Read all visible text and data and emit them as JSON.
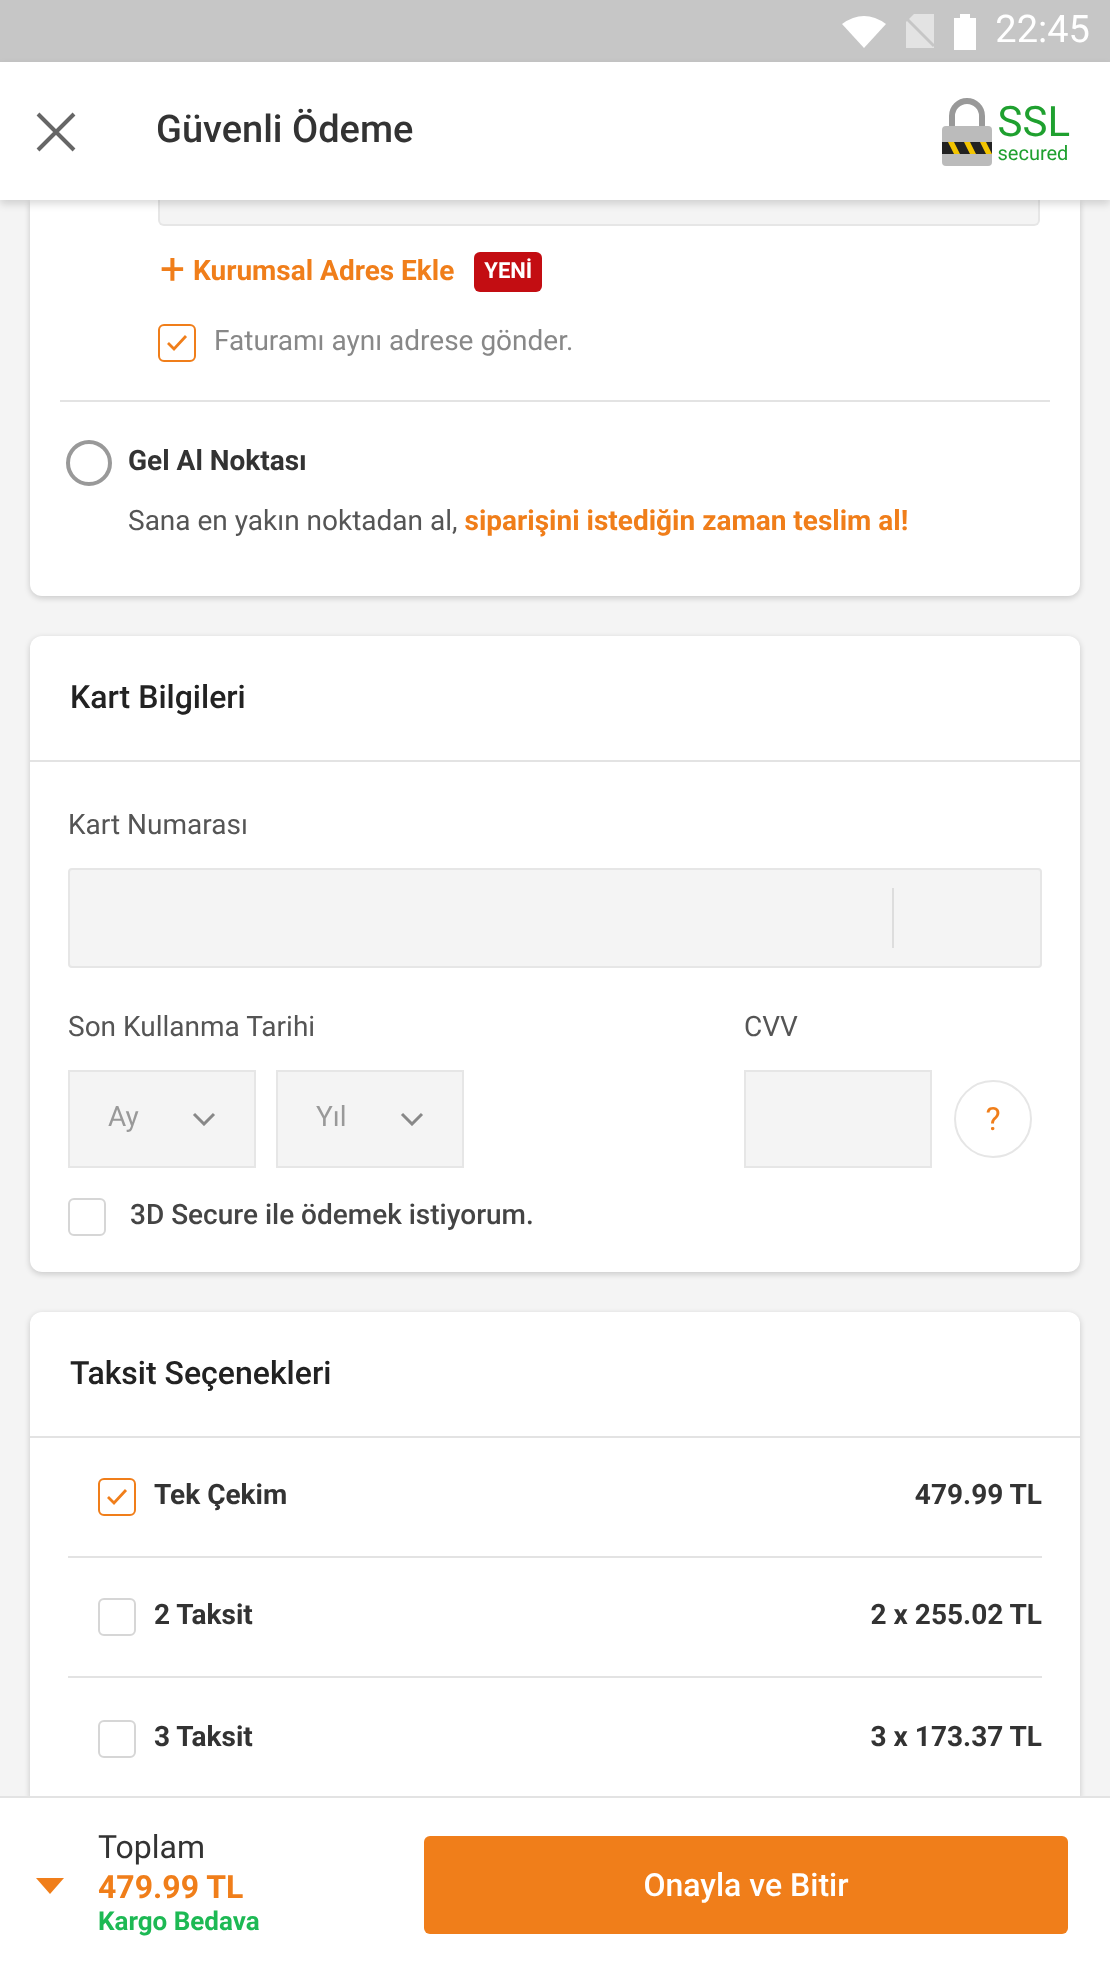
{
  "status_bar": {
    "time": "22:45"
  },
  "header": {
    "title": "Güvenli Ödeme",
    "ssl_badge": {
      "title": "SSL",
      "subtitle": "secured"
    }
  },
  "delivery_card": {
    "add_corporate_address": {
      "icon": "+",
      "label": "Kurumsal Adres Ekle",
      "badge": "YENİ"
    },
    "same_address": {
      "label": "Faturamı aynı adrese gönder.",
      "checked": true
    },
    "pickup_option": {
      "label": "Gel Al Noktası",
      "selected": false,
      "description": "Sana en yakın noktadan al, **siparişini istediğin zaman teslim al!**"
    }
  },
  "card_info": {
    "title": "Kart Bilgileri",
    "card_number_label": "Kart Numarası",
    "expiry_label": "Son Kullanma Tarihi",
    "month_placeholder": "Ay",
    "year_placeholder": "Yıl",
    "cvv_label": "CVV",
    "cvv_help": "?",
    "secure_3d": {
      "label": "3D Secure ile ödemek istiyorum.",
      "checked": false
    }
  },
  "installments": {
    "title": "Taksit Seçenekleri",
    "options": [
      {
        "label": "Tek Çekim",
        "amount": "479.99 TL",
        "selected": true
      },
      {
        "label": "2 Taksit",
        "amount": "2 x 255.02 TL",
        "selected": false
      },
      {
        "label": "3 Taksit",
        "amount": "3 x 173.37 TL",
        "selected": false
      }
    ]
  },
  "footer": {
    "total_label": "Toplam",
    "total": "479.99 TL",
    "shipping": "Kargo Bedava",
    "confirm_button": "Onayla ve Bitir"
  }
}
